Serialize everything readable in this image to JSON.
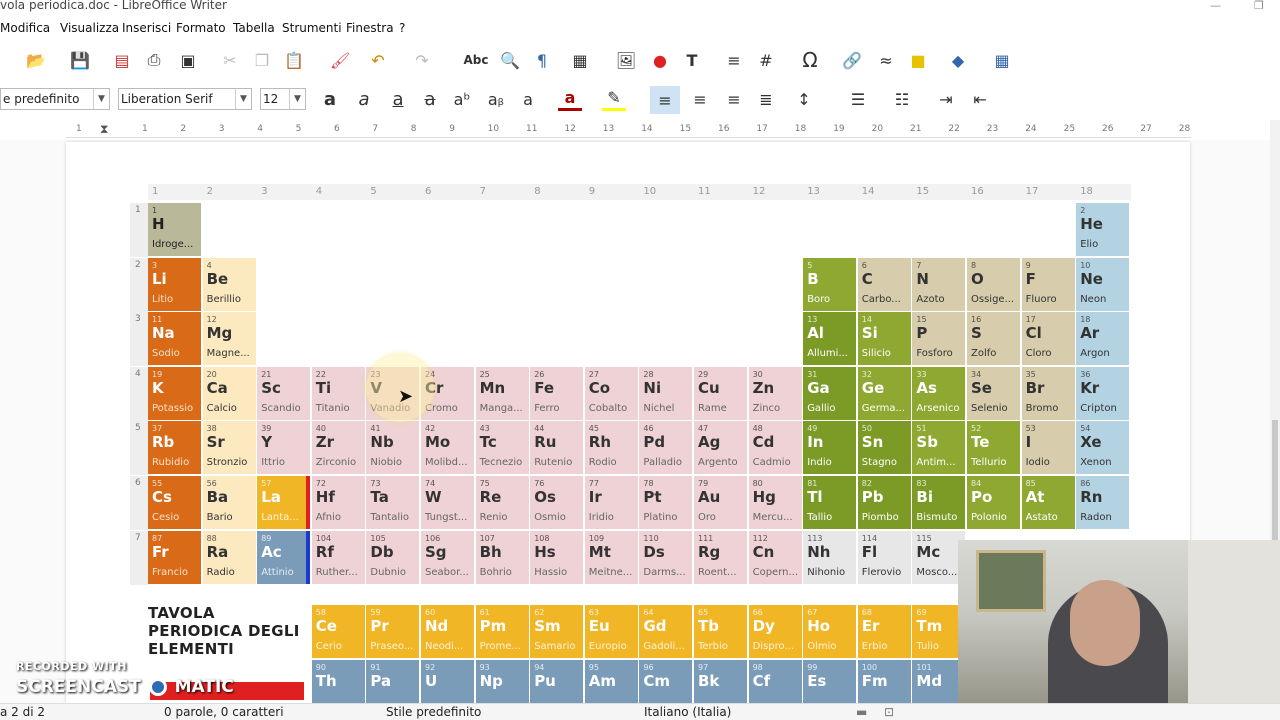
{
  "window": {
    "title": "vola periodica.doc - LibreOffice Writer"
  },
  "menu": [
    "Modifica",
    "Visualizza",
    "Inserisci",
    "Formato",
    "Tabella",
    "Strumenti",
    "Finestra",
    "?"
  ],
  "formatting": {
    "paragraph_style": "e predefinito",
    "font_name": "Liberation Serif",
    "font_size": "12"
  },
  "ruler": [
    "1",
    "1",
    "2",
    "3",
    "4",
    "5",
    "6",
    "7",
    "8",
    "9",
    "10",
    "11",
    "12",
    "13",
    "14",
    "15",
    "16",
    "17",
    "18",
    "19",
    "20",
    "21",
    "22",
    "23",
    "24",
    "25",
    "26",
    "27",
    "28"
  ],
  "table": {
    "groups": [
      "1",
      "2",
      "3",
      "4",
      "5",
      "6",
      "7",
      "8",
      "9",
      "10",
      "11",
      "12",
      "13",
      "14",
      "15",
      "16",
      "17",
      "18"
    ],
    "periods": [
      "1",
      "2",
      "3",
      "4",
      "5",
      "6",
      "7"
    ],
    "elements": [
      {
        "n": "1",
        "s": "H",
        "m": "Idroge...",
        "c": "h",
        "col": 0,
        "row": 0
      },
      {
        "n": "2",
        "s": "He",
        "m": "Elio",
        "c": "ng",
        "col": 17,
        "row": 0
      },
      {
        "n": "3",
        "s": "Li",
        "m": "Litio",
        "c": "alk",
        "col": 0,
        "row": 1
      },
      {
        "n": "4",
        "s": "Be",
        "m": "Berillio",
        "c": "ae",
        "col": 1,
        "row": 1
      },
      {
        "n": "5",
        "s": "B",
        "m": "Boro",
        "c": "mt",
        "col": 12,
        "row": 1
      },
      {
        "n": "6",
        "s": "C",
        "m": "Carbo...",
        "c": "nm",
        "col": 13,
        "row": 1
      },
      {
        "n": "7",
        "s": "N",
        "m": "Azoto",
        "c": "nm",
        "col": 14,
        "row": 1
      },
      {
        "n": "8",
        "s": "O",
        "m": "Ossige...",
        "c": "nm",
        "col": 15,
        "row": 1
      },
      {
        "n": "9",
        "s": "F",
        "m": "Fluoro",
        "c": "nm",
        "col": 16,
        "row": 1
      },
      {
        "n": "10",
        "s": "Ne",
        "m": "Neon",
        "c": "ng",
        "col": 17,
        "row": 1
      },
      {
        "n": "11",
        "s": "Na",
        "m": "Sodio",
        "c": "alk",
        "col": 0,
        "row": 2
      },
      {
        "n": "12",
        "s": "Mg",
        "m": "Magne...",
        "c": "ae",
        "col": 1,
        "row": 2
      },
      {
        "n": "13",
        "s": "Al",
        "m": "Allumi...",
        "c": "pm",
        "col": 12,
        "row": 2
      },
      {
        "n": "14",
        "s": "Si",
        "m": "Silicio",
        "c": "mt",
        "col": 13,
        "row": 2
      },
      {
        "n": "15",
        "s": "P",
        "m": "Fosforo",
        "c": "nm",
        "col": 14,
        "row": 2
      },
      {
        "n": "16",
        "s": "S",
        "m": "Zolfo",
        "c": "nm",
        "col": 15,
        "row": 2
      },
      {
        "n": "17",
        "s": "Cl",
        "m": "Cloro",
        "c": "nm",
        "col": 16,
        "row": 2
      },
      {
        "n": "18",
        "s": "Ar",
        "m": "Argon",
        "c": "ng",
        "col": 17,
        "row": 2
      },
      {
        "n": "19",
        "s": "K",
        "m": "Potassio",
        "c": "alk",
        "col": 0,
        "row": 3
      },
      {
        "n": "20",
        "s": "Ca",
        "m": "Calcio",
        "c": "ae",
        "col": 1,
        "row": 3
      },
      {
        "n": "21",
        "s": "Sc",
        "m": "Scandio",
        "c": "tm",
        "col": 2,
        "row": 3
      },
      {
        "n": "22",
        "s": "Ti",
        "m": "Titanio",
        "c": "tm",
        "col": 3,
        "row": 3
      },
      {
        "n": "23",
        "s": "V",
        "m": "Vanadio",
        "c": "tm",
        "col": 4,
        "row": 3
      },
      {
        "n": "24",
        "s": "Cr",
        "m": "Cromo",
        "c": "tm",
        "col": 5,
        "row": 3
      },
      {
        "n": "25",
        "s": "Mn",
        "m": "Manga...",
        "c": "tm",
        "col": 6,
        "row": 3
      },
      {
        "n": "26",
        "s": "Fe",
        "m": "Ferro",
        "c": "tm",
        "col": 7,
        "row": 3
      },
      {
        "n": "27",
        "s": "Co",
        "m": "Cobalto",
        "c": "tm",
        "col": 8,
        "row": 3
      },
      {
        "n": "28",
        "s": "Ni",
        "m": "Nichel",
        "c": "tm",
        "col": 9,
        "row": 3
      },
      {
        "n": "29",
        "s": "Cu",
        "m": "Rame",
        "c": "tm",
        "col": 10,
        "row": 3
      },
      {
        "n": "30",
        "s": "Zn",
        "m": "Zinco",
        "c": "tm",
        "col": 11,
        "row": 3
      },
      {
        "n": "31",
        "s": "Ga",
        "m": "Gallio",
        "c": "pm",
        "col": 12,
        "row": 3
      },
      {
        "n": "32",
        "s": "Ge",
        "m": "Germa...",
        "c": "mt",
        "col": 13,
        "row": 3
      },
      {
        "n": "33",
        "s": "As",
        "m": "Arsenico",
        "c": "mt",
        "col": 14,
        "row": 3
      },
      {
        "n": "34",
        "s": "Se",
        "m": "Selenio",
        "c": "nm",
        "col": 15,
        "row": 3
      },
      {
        "n": "35",
        "s": "Br",
        "m": "Bromo",
        "c": "nm",
        "col": 16,
        "row": 3
      },
      {
        "n": "36",
        "s": "Kr",
        "m": "Cripton",
        "c": "ng",
        "col": 17,
        "row": 3
      },
      {
        "n": "37",
        "s": "Rb",
        "m": "Rubidio",
        "c": "alk",
        "col": 0,
        "row": 4
      },
      {
        "n": "38",
        "s": "Sr",
        "m": "Stronzio",
        "c": "ae",
        "col": 1,
        "row": 4
      },
      {
        "n": "39",
        "s": "Y",
        "m": "Ittrio",
        "c": "tm",
        "col": 2,
        "row": 4
      },
      {
        "n": "40",
        "s": "Zr",
        "m": "Zirconio",
        "c": "tm",
        "col": 3,
        "row": 4
      },
      {
        "n": "41",
        "s": "Nb",
        "m": "Niobio",
        "c": "tm",
        "col": 4,
        "row": 4
      },
      {
        "n": "42",
        "s": "Mo",
        "m": "Molibd...",
        "c": "tm",
        "col": 5,
        "row": 4
      },
      {
        "n": "43",
        "s": "Tc",
        "m": "Tecnezio",
        "c": "tm",
        "col": 6,
        "row": 4
      },
      {
        "n": "44",
        "s": "Ru",
        "m": "Rutenio",
        "c": "tm",
        "col": 7,
        "row": 4
      },
      {
        "n": "45",
        "s": "Rh",
        "m": "Rodio",
        "c": "tm",
        "col": 8,
        "row": 4
      },
      {
        "n": "46",
        "s": "Pd",
        "m": "Palladio",
        "c": "tm",
        "col": 9,
        "row": 4
      },
      {
        "n": "47",
        "s": "Ag",
        "m": "Argento",
        "c": "tm",
        "col": 10,
        "row": 4
      },
      {
        "n": "48",
        "s": "Cd",
        "m": "Cadmio",
        "c": "tm",
        "col": 11,
        "row": 4
      },
      {
        "n": "49",
        "s": "In",
        "m": "Indio",
        "c": "pm",
        "col": 12,
        "row": 4
      },
      {
        "n": "50",
        "s": "Sn",
        "m": "Stagno",
        "c": "pm",
        "col": 13,
        "row": 4
      },
      {
        "n": "51",
        "s": "Sb",
        "m": "Antim...",
        "c": "mt",
        "col": 14,
        "row": 4
      },
      {
        "n": "52",
        "s": "Te",
        "m": "Tellurio",
        "c": "mt",
        "col": 15,
        "row": 4
      },
      {
        "n": "53",
        "s": "I",
        "m": "Iodio",
        "c": "nm",
        "col": 16,
        "row": 4
      },
      {
        "n": "54",
        "s": "Xe",
        "m": "Xenon",
        "c": "ng",
        "col": 17,
        "row": 4
      },
      {
        "n": "55",
        "s": "Cs",
        "m": "Cesio",
        "c": "alk",
        "col": 0,
        "row": 5
      },
      {
        "n": "56",
        "s": "Ba",
        "m": "Bario",
        "c": "ae",
        "col": 1,
        "row": 5
      },
      {
        "n": "57",
        "s": "La",
        "m": "Lanta...",
        "c": "la",
        "col": 2,
        "row": 5
      },
      {
        "n": "72",
        "s": "Hf",
        "m": "Afnio",
        "c": "tm",
        "col": 3,
        "row": 5
      },
      {
        "n": "73",
        "s": "Ta",
        "m": "Tantalio",
        "c": "tm",
        "col": 4,
        "row": 5
      },
      {
        "n": "74",
        "s": "W",
        "m": "Tungst...",
        "c": "tm",
        "col": 5,
        "row": 5
      },
      {
        "n": "75",
        "s": "Re",
        "m": "Renio",
        "c": "tm",
        "col": 6,
        "row": 5
      },
      {
        "n": "76",
        "s": "Os",
        "m": "Osmio",
        "c": "tm",
        "col": 7,
        "row": 5
      },
      {
        "n": "77",
        "s": "Ir",
        "m": "Iridio",
        "c": "tm",
        "col": 8,
        "row": 5
      },
      {
        "n": "78",
        "s": "Pt",
        "m": "Platino",
        "c": "tm",
        "col": 9,
        "row": 5
      },
      {
        "n": "79",
        "s": "Au",
        "m": "Oro",
        "c": "tm",
        "col": 10,
        "row": 5
      },
      {
        "n": "80",
        "s": "Hg",
        "m": "Mercu...",
        "c": "tm",
        "col": 11,
        "row": 5
      },
      {
        "n": "81",
        "s": "Tl",
        "m": "Tallio",
        "c": "pm",
        "col": 12,
        "row": 5
      },
      {
        "n": "82",
        "s": "Pb",
        "m": "Piombo",
        "c": "pm",
        "col": 13,
        "row": 5
      },
      {
        "n": "83",
        "s": "Bi",
        "m": "Bismuto",
        "c": "pm",
        "col": 14,
        "row": 5
      },
      {
        "n": "84",
        "s": "Po",
        "m": "Polonio",
        "c": "mt",
        "col": 15,
        "row": 5
      },
      {
        "n": "85",
        "s": "At",
        "m": "Astato",
        "c": "mt",
        "col": 16,
        "row": 5
      },
      {
        "n": "86",
        "s": "Rn",
        "m": "Radon",
        "c": "ng",
        "col": 17,
        "row": 5
      },
      {
        "n": "87",
        "s": "Fr",
        "m": "Francio",
        "c": "alk",
        "col": 0,
        "row": 6
      },
      {
        "n": "88",
        "s": "Ra",
        "m": "Radio",
        "c": "ae",
        "col": 1,
        "row": 6
      },
      {
        "n": "89",
        "s": "Ac",
        "m": "Attinio",
        "c": "ac",
        "col": 2,
        "row": 6
      },
      {
        "n": "104",
        "s": "Rf",
        "m": "Ruther...",
        "c": "tm",
        "col": 3,
        "row": 6
      },
      {
        "n": "105",
        "s": "Db",
        "m": "Dubnio",
        "c": "tm",
        "col": 4,
        "row": 6
      },
      {
        "n": "106",
        "s": "Sg",
        "m": "Seabor...",
        "c": "tm",
        "col": 5,
        "row": 6
      },
      {
        "n": "107",
        "s": "Bh",
        "m": "Bohrio",
        "c": "tm",
        "col": 6,
        "row": 6
      },
      {
        "n": "108",
        "s": "Hs",
        "m": "Hassio",
        "c": "tm",
        "col": 7,
        "row": 6
      },
      {
        "n": "109",
        "s": "Mt",
        "m": "Meitne...",
        "c": "tm",
        "col": 8,
        "row": 6
      },
      {
        "n": "110",
        "s": "Ds",
        "m": "Darms...",
        "c": "tm",
        "col": 9,
        "row": 6
      },
      {
        "n": "111",
        "s": "Rg",
        "m": "Roent...",
        "c": "tm",
        "col": 10,
        "row": 6
      },
      {
        "n": "112",
        "s": "Cn",
        "m": "Copern...",
        "c": "tm",
        "col": 11,
        "row": 6
      },
      {
        "n": "113",
        "s": "Nh",
        "m": "Nihonio",
        "c": "met",
        "col": 12,
        "row": 6
      },
      {
        "n": "114",
        "s": "Fl",
        "m": "Flerovio",
        "c": "met",
        "col": 13,
        "row": 6
      },
      {
        "n": "115",
        "s": "Mc",
        "m": "Mosco...",
        "c": "met",
        "col": 14,
        "row": 6
      }
    ],
    "lanthanides": [
      {
        "n": "58",
        "s": "Ce",
        "m": "Cerio"
      },
      {
        "n": "59",
        "s": "Pr",
        "m": "Praseo..."
      },
      {
        "n": "60",
        "s": "Nd",
        "m": "Neodi..."
      },
      {
        "n": "61",
        "s": "Pm",
        "m": "Prome..."
      },
      {
        "n": "62",
        "s": "Sm",
        "m": "Samario"
      },
      {
        "n": "63",
        "s": "Eu",
        "m": "Europio"
      },
      {
        "n": "64",
        "s": "Gd",
        "m": "Gadoli..."
      },
      {
        "n": "65",
        "s": "Tb",
        "m": "Terbio"
      },
      {
        "n": "66",
        "s": "Dy",
        "m": "Dispro..."
      },
      {
        "n": "67",
        "s": "Ho",
        "m": "Olmio"
      },
      {
        "n": "68",
        "s": "Er",
        "m": "Erbio"
      },
      {
        "n": "69",
        "s": "Tm",
        "m": "Tulio"
      }
    ],
    "actinides": [
      {
        "n": "90",
        "s": "Th",
        "m": ""
      },
      {
        "n": "91",
        "s": "Pa",
        "m": ""
      },
      {
        "n": "92",
        "s": "U",
        "m": ""
      },
      {
        "n": "93",
        "s": "Np",
        "m": ""
      },
      {
        "n": "94",
        "s": "Pu",
        "m": ""
      },
      {
        "n": "95",
        "s": "Am",
        "m": ""
      },
      {
        "n": "96",
        "s": "Cm",
        "m": ""
      },
      {
        "n": "97",
        "s": "Bk",
        "m": ""
      },
      {
        "n": "98",
        "s": "Cf",
        "m": ""
      },
      {
        "n": "99",
        "s": "Es",
        "m": ""
      },
      {
        "n": "100",
        "s": "Fm",
        "m": ""
      },
      {
        "n": "101",
        "s": "Md",
        "m": ""
      }
    ],
    "legend_title": "TAVOLA PERIODICA DEGLI ELEMENTI"
  },
  "status": {
    "page": "a 2 di 2",
    "words": "0 parole, 0 caratteri",
    "style": "Stile predefinito",
    "language": "Italiano (Italia)"
  },
  "watermark": {
    "line1": "RECORDED WITH",
    "line2": "SCREENCAST",
    "line3": "MATIC"
  },
  "colors": {
    "alkali": "#d96a18",
    "earth": "#fde9c0",
    "transition": "#eed2d5",
    "lanthanide": "#f0b626",
    "actinide": "#7b9cb8",
    "noble": "#b3d3e2",
    "metalloid": "#8fa832",
    "post_metal": "#7c9a26",
    "nonmetal": "#d7ccab"
  }
}
